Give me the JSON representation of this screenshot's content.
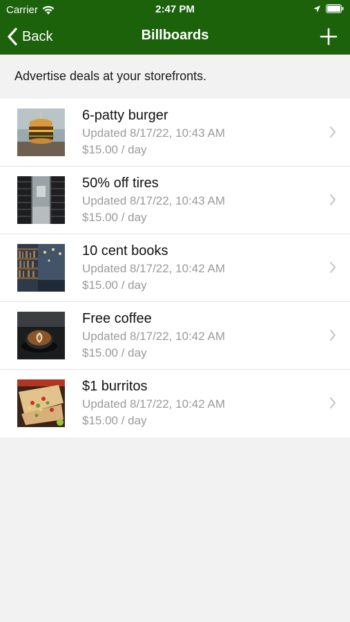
{
  "status_bar": {
    "carrier": "Carrier",
    "time": "2:47 PM",
    "icons": [
      "wifi-icon",
      "location-icon",
      "battery-icon"
    ]
  },
  "nav": {
    "back_label": "Back",
    "title": "Billboards",
    "add_icon": "plus-icon"
  },
  "subtitle": "Advertise deals at your storefronts.",
  "billboards": [
    {
      "title": "6-patty burger",
      "updated": "Updated 8/17/22, 10:43 AM",
      "price": "$15.00 / day",
      "image": "burger-photo"
    },
    {
      "title": "50% off tires",
      "updated": "Updated 8/17/22, 10:43 AM",
      "price": "$15.00 / day",
      "image": "tires-photo"
    },
    {
      "title": "10 cent books",
      "updated": "Updated 8/17/22, 10:42 AM",
      "price": "$15.00 / day",
      "image": "books-photo"
    },
    {
      "title": "Free coffee",
      "updated": "Updated 8/17/22, 10:42 AM",
      "price": "$15.00 / day",
      "image": "coffee-photo"
    },
    {
      "title": "$1 burritos",
      "updated": "Updated 8/17/22, 10:42 AM",
      "price": "$15.00 / day",
      "image": "burritos-photo"
    }
  ],
  "colors": {
    "header_bg": "#1b620b",
    "page_bg": "#f2f2f2",
    "secondary_text": "#9a9a9a"
  }
}
